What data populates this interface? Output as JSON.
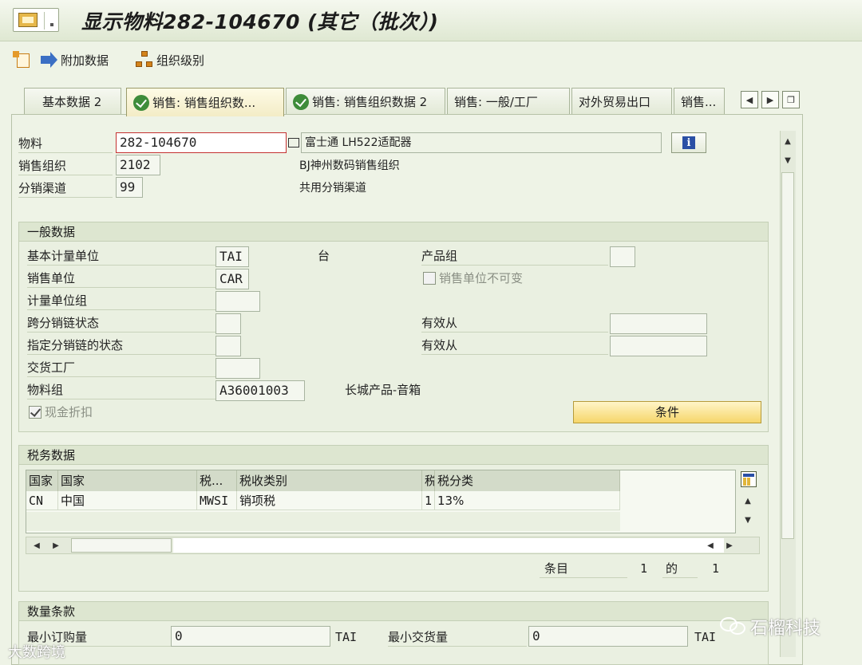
{
  "window": {
    "title": "显示物料282-104670 (其它（批次）)"
  },
  "toolbar": {
    "additional_data": "附加数据",
    "org_levels": "组织级别"
  },
  "tabs": [
    {
      "label": "基本数据 2"
    },
    {
      "label": "销售: 销售组织数..."
    },
    {
      "label": "销售: 销售组织数据 2"
    },
    {
      "label": "销售: 一般/工厂"
    },
    {
      "label": "对外贸易出口"
    },
    {
      "label": "销售..."
    }
  ],
  "header": {
    "material_label": "物料",
    "material_value": "282-104670",
    "material_desc": "富士通 LH522适配器",
    "sales_org_label": "销售组织",
    "sales_org_value": "2102",
    "sales_org_desc": "BJ神州数码销售组织",
    "dist_channel_label": "分销渠道",
    "dist_channel_value": "99",
    "dist_channel_desc": "共用分销渠道"
  },
  "general": {
    "title": "一般数据",
    "base_uom_label": "基本计量单位",
    "base_uom_value": "TAI",
    "base_uom_text": "台",
    "sales_unit_label": "销售单位",
    "sales_unit_value": "CAR",
    "uom_group_label": "计量单位组",
    "x_chain_status_label": "跨分销链状态",
    "chain_status_label": "指定分销链的状态",
    "delivery_plant_label": "交货工厂",
    "material_group_label": "物料组",
    "material_group_value": "A36001003",
    "material_group_desc": "长城产品-音箱",
    "cash_discount_label": "现金折扣",
    "product_group_label": "产品组",
    "sales_unit_fixed_label": "销售单位不可变",
    "valid_from_1_label": "有效从",
    "valid_from_2_label": "有效从",
    "conditions_button": "条件"
  },
  "tax": {
    "title": "税务数据",
    "columns": [
      "国家",
      "国家",
      "税...",
      "税收类别",
      "税",
      "税分类"
    ],
    "rows": [
      [
        "CN",
        "中国",
        "MWSI",
        "销项税",
        "1",
        "13%"
      ]
    ],
    "entries_label": "条目",
    "entry_current": "1",
    "of_label": "的",
    "entry_total": "1"
  },
  "quantity": {
    "title": "数量条款",
    "min_order_label": "最小订购量",
    "min_order_value": "0",
    "min_order_unit": "TAI",
    "min_delivery_label": "最小交货量",
    "min_delivery_value": "0",
    "min_delivery_unit": "TAI"
  },
  "watermarks": {
    "right": "石榴科技",
    "left": "大数跨境"
  }
}
